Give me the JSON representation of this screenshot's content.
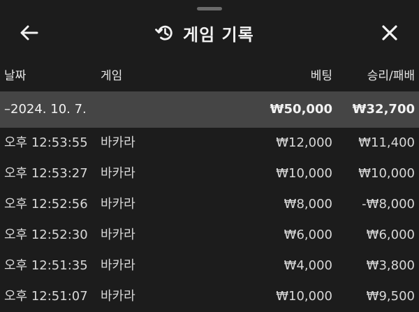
{
  "header": {
    "title": "게임 기록",
    "back_icon": "arrow-left-icon",
    "history_icon": "history-icon",
    "close_icon": "close-icon"
  },
  "columns": {
    "date": "날짜",
    "game": "게임",
    "bet": "베팅",
    "result": "승리/패배"
  },
  "date_group": {
    "label": "–2024. 10. 7.",
    "bet_total": "₩50,000",
    "result_total": "₩32,700"
  },
  "rows": [
    {
      "time": "오후 12:53:55",
      "game": "바카라",
      "bet": "₩12,000",
      "result": "₩11,400"
    },
    {
      "time": "오후 12:53:27",
      "game": "바카라",
      "bet": "₩10,000",
      "result": "₩10,000"
    },
    {
      "time": "오후 12:52:56",
      "game": "바카라",
      "bet": "₩8,000",
      "result": "-₩8,000"
    },
    {
      "time": "오후 12:52:30",
      "game": "바카라",
      "bet": "₩6,000",
      "result": "₩6,000"
    },
    {
      "time": "오후 12:51:35",
      "game": "바카라",
      "bet": "₩4,000",
      "result": "₩3,800"
    },
    {
      "time": "오후 12:51:07",
      "game": "바카라",
      "bet": "₩10,000",
      "result": "₩9,500"
    }
  ]
}
